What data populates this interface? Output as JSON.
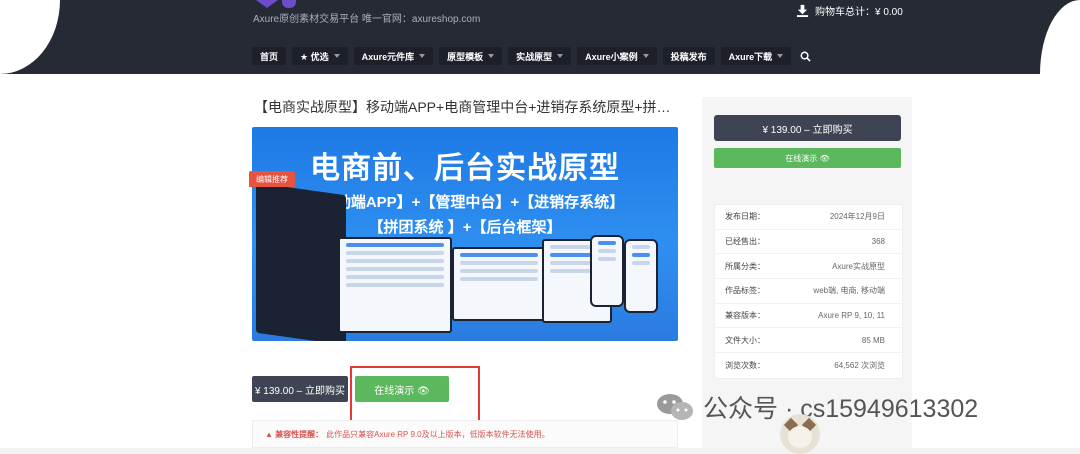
{
  "header": {
    "tagline": "Axure原创素材交易平台 唯一官网：axureshop.com",
    "cart_label": "购物车总计：¥ 0.00"
  },
  "nav": {
    "items": [
      {
        "label": "首页",
        "caret": false
      },
      {
        "label": "★ 优选",
        "caret": true
      },
      {
        "label": "Axure元件库",
        "caret": true
      },
      {
        "label": "原型模板",
        "caret": true
      },
      {
        "label": "实战原型",
        "caret": true
      },
      {
        "label": "Axure小案例",
        "caret": true
      },
      {
        "label": "投稿发布",
        "caret": false
      },
      {
        "label": "Axure下载",
        "caret": true
      }
    ]
  },
  "product": {
    "title": "【电商实战原型】移动端APP+电商管理中台+进销存系统原型+拼团系统+后…",
    "banner_title": "电商前、后台实战原型",
    "banner_line1": "【移动端APP】+【管理中台】+【进销存系统】",
    "banner_line2": "【拼团系统 】+【后台框架】",
    "badge": "编辑推荐",
    "buy_label": "¥ 139.00 – 立即购买",
    "demo_label": "在线演示 👁",
    "compat_warn": "▲ 兼容性提醒：",
    "compat_text": "此作品只兼容Axure RP 9.0及以上版本，低版本软件无法使用。"
  },
  "sidebar": {
    "buy_label": "¥ 139.00 – 立即购买",
    "demo_label": "在线演示 👁",
    "info": [
      {
        "k": "发布日期：",
        "v": "2024年12月9日"
      },
      {
        "k": "已经售出：",
        "v": "368"
      },
      {
        "k": "所属分类：",
        "v": "Axure实战原型"
      },
      {
        "k": "作品标签：",
        "v": "web端, 电商, 移动端"
      },
      {
        "k": "兼容版本：",
        "v": "Axure RP 9, 10, 11"
      },
      {
        "k": "文件大小：",
        "v": "85 MB"
      },
      {
        "k": "浏览次数：",
        "v": "64,562 次浏览"
      }
    ]
  },
  "watermark": {
    "text": "公众号 · cs15949613302"
  }
}
